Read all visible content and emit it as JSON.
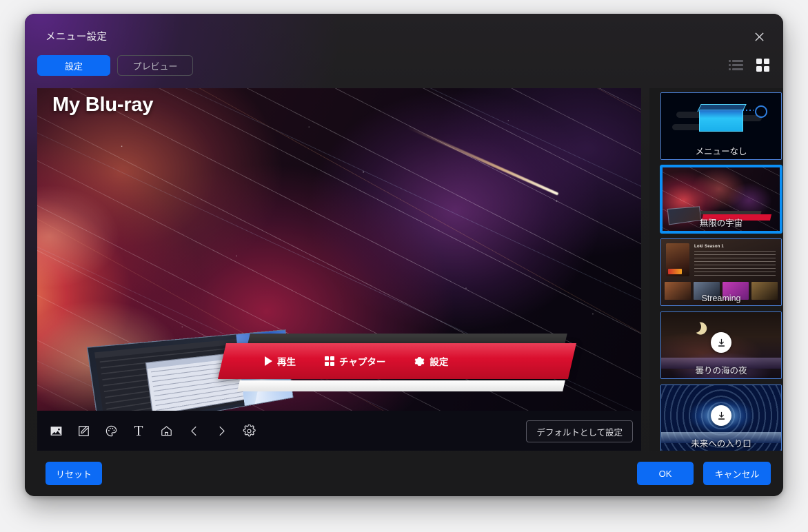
{
  "dialog": {
    "title": "メニュー設定",
    "close_label": "×"
  },
  "tabs": [
    {
      "label": "設定",
      "active": true
    },
    {
      "label": "プレビュー",
      "active": false
    }
  ],
  "view_toggle": {
    "list_icon": "list-view-icon",
    "grid_icon": "grid-view-icon",
    "active": "grid"
  },
  "preview": {
    "disc_title": "My Blu-ray",
    "menu_items": [
      {
        "icon": "play-icon",
        "label": "再生"
      },
      {
        "icon": "chapters-grid-icon",
        "label": "チャプター"
      },
      {
        "icon": "gear-icon",
        "label": "設定"
      }
    ],
    "toolbar": [
      {
        "icon": "image-icon",
        "name": "background-image-tool"
      },
      {
        "icon": "edit-square-icon",
        "name": "edit-tool"
      },
      {
        "icon": "palette-icon",
        "name": "color-palette-tool"
      },
      {
        "icon": "text-icon",
        "name": "text-tool",
        "glyph": "T"
      },
      {
        "icon": "home-icon",
        "name": "home-tool"
      },
      {
        "icon": "chevron-left-icon",
        "name": "previous-page-tool"
      },
      {
        "icon": "chevron-right-icon",
        "name": "next-page-tool"
      },
      {
        "icon": "gear-icon",
        "name": "settings-tool"
      }
    ],
    "default_button": "デフォルトとして設定"
  },
  "templates": [
    {
      "label": "メニューなし",
      "art": "nomenu",
      "selected": false,
      "download": false
    },
    {
      "label": "無限の宇宙",
      "art": "cosmos",
      "selected": true,
      "download": false
    },
    {
      "label": "Streaming",
      "art": "stream",
      "selected": false,
      "download": false
    },
    {
      "label": "曇りの海の夜",
      "art": "night",
      "selected": false,
      "download": true
    },
    {
      "label": "未来への入り口",
      "art": "future",
      "selected": false,
      "download": true
    }
  ],
  "template_extra": {
    "streaming_title": "Loki Season 1"
  },
  "footer": {
    "reset": "リセット",
    "ok": "OK",
    "cancel": "キャンセル"
  },
  "colors": {
    "accent_blue": "#0c6bf5",
    "selected_border": "#0b8ff5",
    "menu_red": "#d90f2e",
    "dialog_bg": "#1e1e1e",
    "panel_bg": "#1a1a1b"
  }
}
